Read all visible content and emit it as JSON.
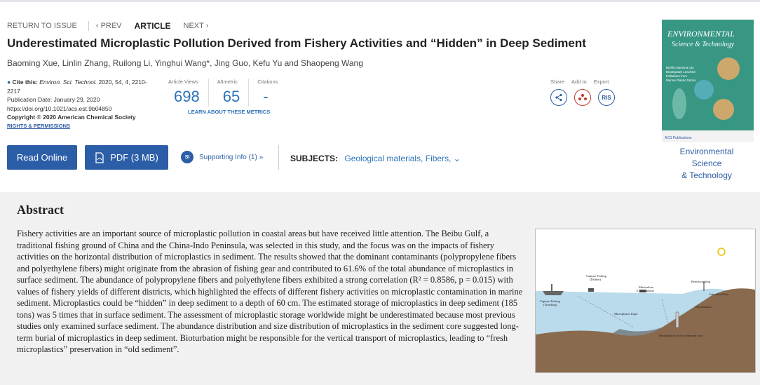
{
  "nav": {
    "return": "RETURN TO ISSUE",
    "prev": "‹ PREV",
    "article": "ARTICLE",
    "next": "NEXT ›"
  },
  "title": "Underestimated Microplastic Pollution Derived from Fishery Activities and “Hidden” in Deep Sediment",
  "authors": "Baoming Xue, Linlin Zhang, Ruilong Li, Yinghui Wang*, Jing Guo, Kefu Yu and Shaopeng Wang",
  "citation": {
    "label": "Cite this:",
    "journal": "Environ. Sci. Technol.",
    "ref": "2020, 54, 4, 2210-2217",
    "pub_date": "Publication Date: January 29, 2020",
    "doi": "https://doi.org/10.1021/acs.est.9b04850",
    "copyright": "Copyright © 2020 American Chemical Society",
    "rights": "RIGHTS & PERMISSIONS"
  },
  "metrics": {
    "views_label": "Article Views",
    "views": "698",
    "altmetric_label": "Altmetric",
    "altmetric": "65",
    "citations_label": "Citations",
    "citations": "-",
    "learn": "LEARN ABOUT THESE METRICS"
  },
  "share": {
    "share_label": "Share",
    "add_label": "Add to",
    "export_label": "Export",
    "ris": "RIS"
  },
  "cover": {
    "title_line1": "Environmental Science",
    "title_line2": "& Technology",
    "logo_line1": "ENVIRONMENTAL",
    "logo_line2": "Science & Technology",
    "cover_text": "Biofilm Bacteria can Biodegrade Leached Pollutants from Marine Plastic Debris",
    "publisher": "ACS Publications"
  },
  "buttons": {
    "read": "Read Online",
    "pdf": "PDF (3 MB)",
    "si_badge": "SI",
    "si": "Supporting Info (1) »"
  },
  "subjects": {
    "label": "SUBJECTS:",
    "links": "Geological materials, Fibers,",
    "more": "⌄"
  },
  "abstract": {
    "heading": "Abstract",
    "text": "Fishery activities are an important source of microplastic pollution in coastal areas but have received little attention. The Beibu Gulf, a traditional fishing ground of China and the China-Indo Peninsula, was selected in this study, and the focus was on the impacts of fishery activities on the horizontal distribution of microplastics in sediment. The results showed that the dominant contaminants (polypropylene fibers and polyethylene fibers) might originate from the abrasion of fishing gear and contributed to 61.6% of the total abundance of microplastics in surface sediment. The abundance of polypropylene fibers and polyethylene fibers exhibited a strong correlation (R² = 0.8586, p = 0.015) with values of fishery yields of different districts, which highlighted the effects of different fishery activities on microplastic contamination in marine sediment. Microplastics could be “hidden” in deep sediment to a depth of 60 cm. The estimated storage of microplastics in deep sediment (185 tons) was 5 times that in surface sediment. The assessment of microplastic storage worldwide might be underestimated because most previous studies only examined surface sediment. The abundance distribution and size distribution of microplastics in the sediment core suggested long-term burial of microplastics in deep sediment. Bioturbation might be responsible for the vertical transport of microplastics, leading to “fresh microplastics” preservation in “old sediment”."
  },
  "toc_graphic": {
    "capture_drifnet_1": "Capture Fishing",
    "capture_drifnet_2": "(Drifnet)",
    "capture_trawling_1": "Capture Fishing",
    "capture_trawling_2": "(Trawling)",
    "mariculture_1": "Mariculture",
    "mariculture_2": "(Caged culture)",
    "beachcombing": "Beachcombing",
    "intertidal": "Intertidal Zone",
    "microplastic_input": "Microplastic Input",
    "bioturbation": "Bioturbation",
    "sediment_core": "Microplastics in the sediment core"
  }
}
